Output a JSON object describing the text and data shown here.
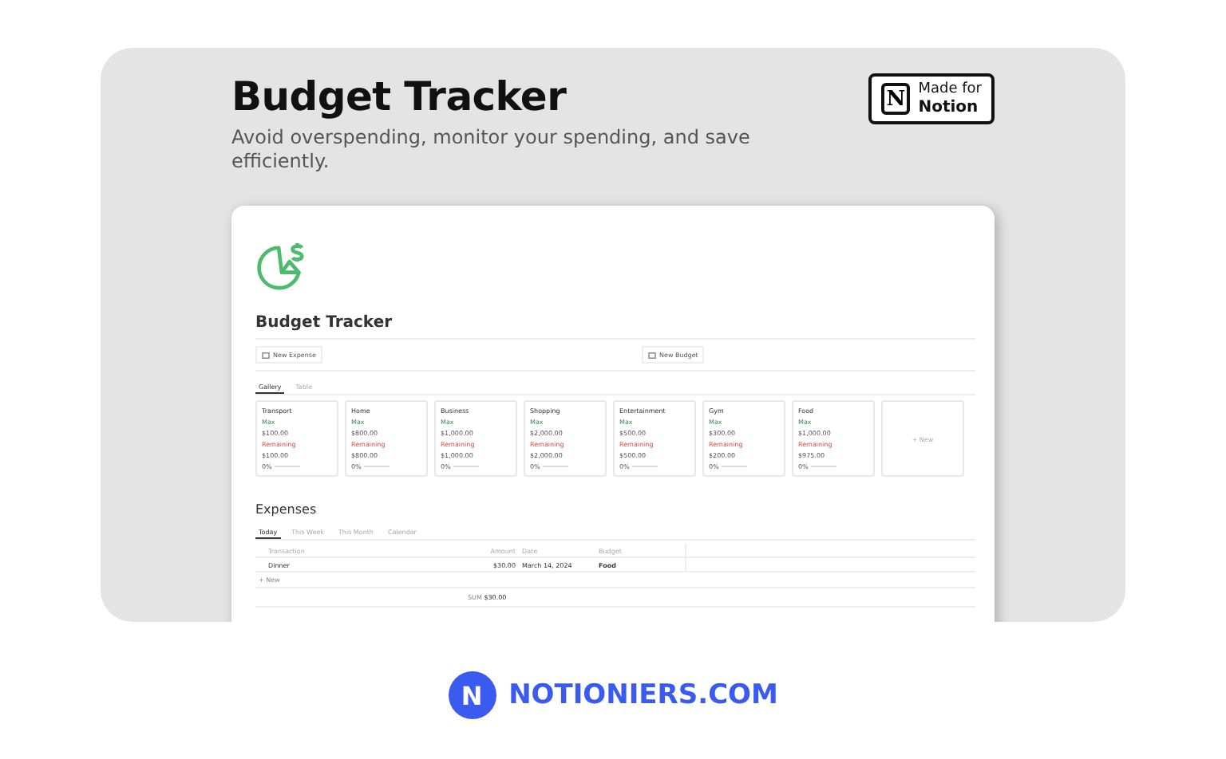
{
  "header": {
    "title": "Budget Tracker",
    "subtitle": "Avoid overspending, monitor your spending, and save efficiently.",
    "badge": {
      "small": "Made for",
      "large": "Notion",
      "logo": "N"
    }
  },
  "page": {
    "title": "Budget Tracker",
    "buttons": [
      "New Expense",
      "New Budget"
    ],
    "views": [
      {
        "label": "Gallery",
        "selected": true
      },
      {
        "label": "Table",
        "selected": false
      }
    ],
    "cards": [
      {
        "name": "Transport",
        "max_label": "Max",
        "max": "$100.00",
        "remaining_label": "Remaining",
        "remaining": "$100.00",
        "percent": "0%",
        "level": 0
      },
      {
        "name": "Home",
        "max_label": "Max",
        "max": "$800.00",
        "remaining_label": "Remaining",
        "remaining": "$800.00",
        "percent": "0%",
        "level": 0
      },
      {
        "name": "Business",
        "max_label": "Max",
        "max": "$1,000.00",
        "remaining_label": "Remaining",
        "remaining": "$1,000.00",
        "percent": "0%",
        "level": 0
      },
      {
        "name": "Shopping",
        "max_label": "Max",
        "max": "$2,000.00",
        "remaining_label": "Remaining",
        "remaining": "$2,000.00",
        "percent": "0%",
        "level": 0
      },
      {
        "name": "Entertainment",
        "max_label": "Max",
        "max": "$500.00",
        "remaining_label": "Remaining",
        "remaining": "$500.00",
        "percent": "0%",
        "level": 0
      },
      {
        "name": "Gym",
        "max_label": "Max",
        "max": "$300.00",
        "remaining_label": "Remaining",
        "remaining": "$200.00",
        "percent": "0%",
        "level": 0
      },
      {
        "name": "Food",
        "max_label": "Max",
        "max": "$1,000.00",
        "remaining_label": "Remaining",
        "remaining": "$975.00",
        "percent": "0%",
        "level": 0
      }
    ],
    "new_card": "+ New",
    "expenses": {
      "title": "Expenses",
      "views": [
        {
          "label": "Today",
          "selected": true
        },
        {
          "label": "This Week",
          "selected": false
        },
        {
          "label": "This Month",
          "selected": false
        },
        {
          "label": "Calendar",
          "selected": false
        }
      ],
      "columns": [
        "Transaction",
        "Amount",
        "Date",
        "Budget"
      ],
      "rows": [
        {
          "transaction": "Dinner",
          "amount": "$30.00",
          "date": "March 14, 2024",
          "budget": "Food"
        }
      ],
      "new_row": "+ New",
      "sum_label": "SUM",
      "sum": "$30.00"
    }
  },
  "footer": {
    "logo": "N",
    "brand": "NOTIONIERS.COM"
  }
}
